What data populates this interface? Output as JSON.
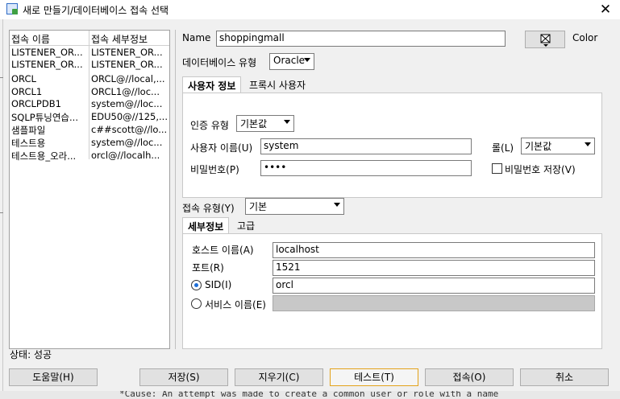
{
  "window": {
    "title": "새로 만들기/데이터베이스 접속 선택",
    "close_glyph": "✕"
  },
  "connections": {
    "headers": [
      "접속 이름",
      "접속 세부정보"
    ],
    "rows": [
      {
        "name": "LISTENER_OR...",
        "detail": "LISTENER_OR..."
      },
      {
        "name": "LISTENER_OR...",
        "detail": "LISTENER_OR..."
      },
      {
        "name": "ORCL",
        "detail": "ORCL@//local,..."
      },
      {
        "name": "ORCL1",
        "detail": "ORCL1@//loc..."
      },
      {
        "name": "ORCLPDB1",
        "detail": "system@//loc..."
      },
      {
        "name": "SQLP튜닝연습...",
        "detail": "EDU50@//125,..."
      },
      {
        "name": "샘플파일",
        "detail": "c##scott@//lo..."
      },
      {
        "name": "테스트용",
        "detail": "system@//loc..."
      },
      {
        "name": "테스트용_오라...",
        "detail": "orcl@//localh..."
      }
    ]
  },
  "form": {
    "name_label": "Name",
    "name_value": "shoppingmall",
    "color_label": "Color",
    "db_type_label": "데이터베이스 유형",
    "db_type_value": "Oracle",
    "tabs": [
      "사용자 정보",
      "프록시 사용자"
    ],
    "auth_type_label": "인증 유형",
    "auth_type_value": "기본값",
    "username_label": "사용자 이름(U)",
    "username_value": "system",
    "role_label": "롤(L)",
    "role_value": "기본값",
    "password_label": "비밀번호(P)",
    "password_value": "••••",
    "save_password_label": "비밀번호 저장(V)",
    "save_password_checked": false,
    "conn_type_label": "접속 유형(Y)",
    "conn_type_value": "기본",
    "detail_tabs": [
      "세부정보",
      "고급"
    ],
    "host_label": "호스트 이름(A)",
    "host_value": "localhost",
    "port_label": "포트(R)",
    "port_value": "1521",
    "sid_label": "SID(I)",
    "sid_value": "orcl",
    "sid_selected": true,
    "service_label": "서비스 이름(E)",
    "service_value": ""
  },
  "status": {
    "text": "상태: 성공"
  },
  "buttons": {
    "help": "도움말(H)",
    "save": "저장(S)",
    "clear": "지우기(C)",
    "test": "테스트(T)",
    "connect": "접속(O)",
    "cancel": "취소"
  },
  "background_text": "*Cause:    An attempt was made to create a common user or role with a name"
}
